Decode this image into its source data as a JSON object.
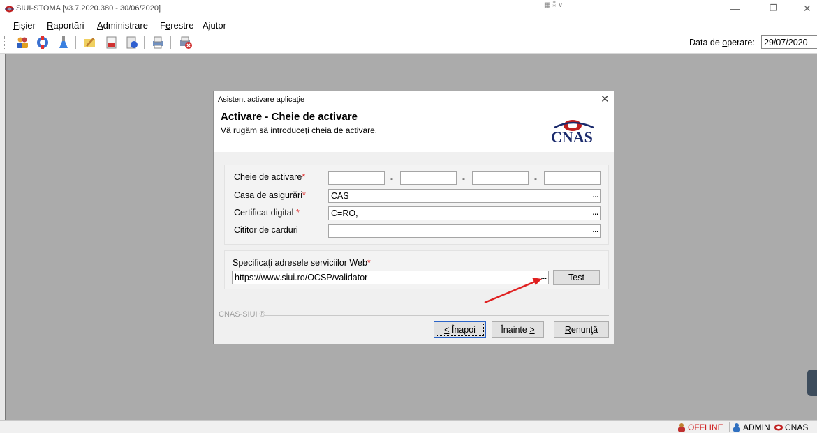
{
  "window": {
    "title": "SIUI-STOMA [v3.7.2020.380 - 30/06/2020]",
    "center_glyph": "▦ ⁑ ∨"
  },
  "menu": [
    {
      "label": "Fișier",
      "ul": "F",
      "rest": "ișier"
    },
    {
      "label": "Raportări",
      "ul": "R",
      "rest": "aportări"
    },
    {
      "label": "Administrare",
      "ul": "A",
      "rest": "dministrare"
    },
    {
      "label": "Ferestre",
      "pre": "F",
      "ul": "e",
      "rest": "restre"
    },
    {
      "label": "Ajutor"
    }
  ],
  "toolbar": {
    "icons": [
      "patients-icon",
      "lifebuoy-icon",
      "flask-icon",
      "pencil-icon",
      "report-icon",
      "prescription-icon",
      "printer-icon",
      "close-printer-icon"
    ],
    "operation_date_label_pre": "Data de ",
    "operation_date_label_ul": "o",
    "operation_date_label_rest": "perare:",
    "operation_date": "29/07/2020"
  },
  "dialog": {
    "title": "Asistent activare aplicaţie",
    "heading": "Activare - Cheie de activare",
    "subtitle": "Vă rugăm să introduceţi cheia de activare.",
    "logo_text": "CNAS",
    "fields": {
      "activation_key": {
        "label_ul": "C",
        "label_rest": "heie de activare",
        "required": "*",
        "parts": [
          "",
          "",
          "",
          ""
        ],
        "separator": "-"
      },
      "insurance_house": {
        "label": "Casa de asigurări",
        "required": "*",
        "value": "CAS"
      },
      "certificate": {
        "label": "Certificat digital",
        "required": "*",
        "value": "C=RO,"
      },
      "card_reader": {
        "label": "Cititor de carduri",
        "value": ""
      }
    },
    "web_services": {
      "label": "Specificaţi adresele serviciilor Web",
      "required": "*",
      "value": "https://www.siui.ro/OCSP/validator",
      "test_label": "Test"
    },
    "ellipsis": "...",
    "footer_label": "CNAS-SIUI ®",
    "buttons": {
      "back_ul": "<",
      "back_rest": " Înapoi",
      "next_pre": "Înainte ",
      "next_ul": ">",
      "cancel_ul": "R",
      "cancel_rest": "enunţă"
    }
  },
  "status": {
    "offline": "OFFLINE",
    "user": "ADMIN",
    "org": "CNAS"
  },
  "colors": {
    "workspace": "#ababab",
    "offline": "#d02020",
    "arrow": "#e02020",
    "logo": "#1a2a6c"
  }
}
